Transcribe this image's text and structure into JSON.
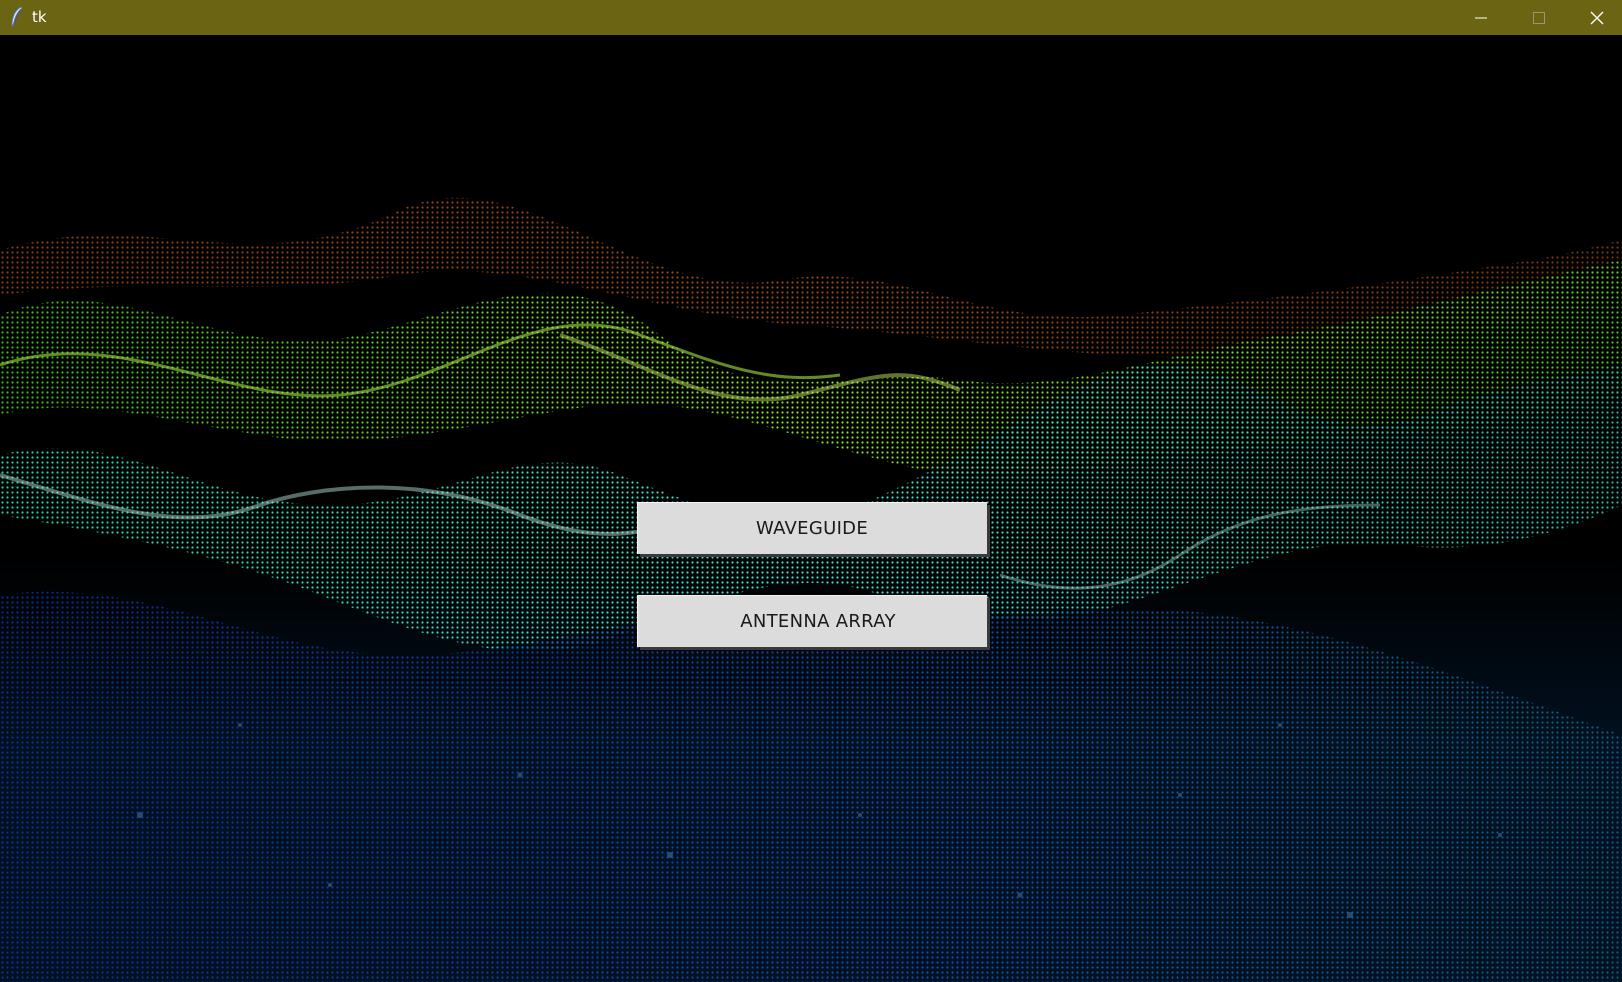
{
  "window": {
    "title": "tk",
    "icon": "feather-icon",
    "controls": {
      "minimize": "minimize-icon",
      "maximize": "maximize-icon",
      "close": "close-icon"
    },
    "titlebar_color": "#6b6412"
  },
  "background": {
    "description_icon": "particle-wave-background",
    "colors": [
      "#000000",
      "#ff7a1a",
      "#7cff2a",
      "#2fffd2",
      "#1a5cff"
    ]
  },
  "buttons": {
    "waveguide_label": "WAVEGUIDE",
    "antenna_label": "ANTENNA ARRAY"
  }
}
